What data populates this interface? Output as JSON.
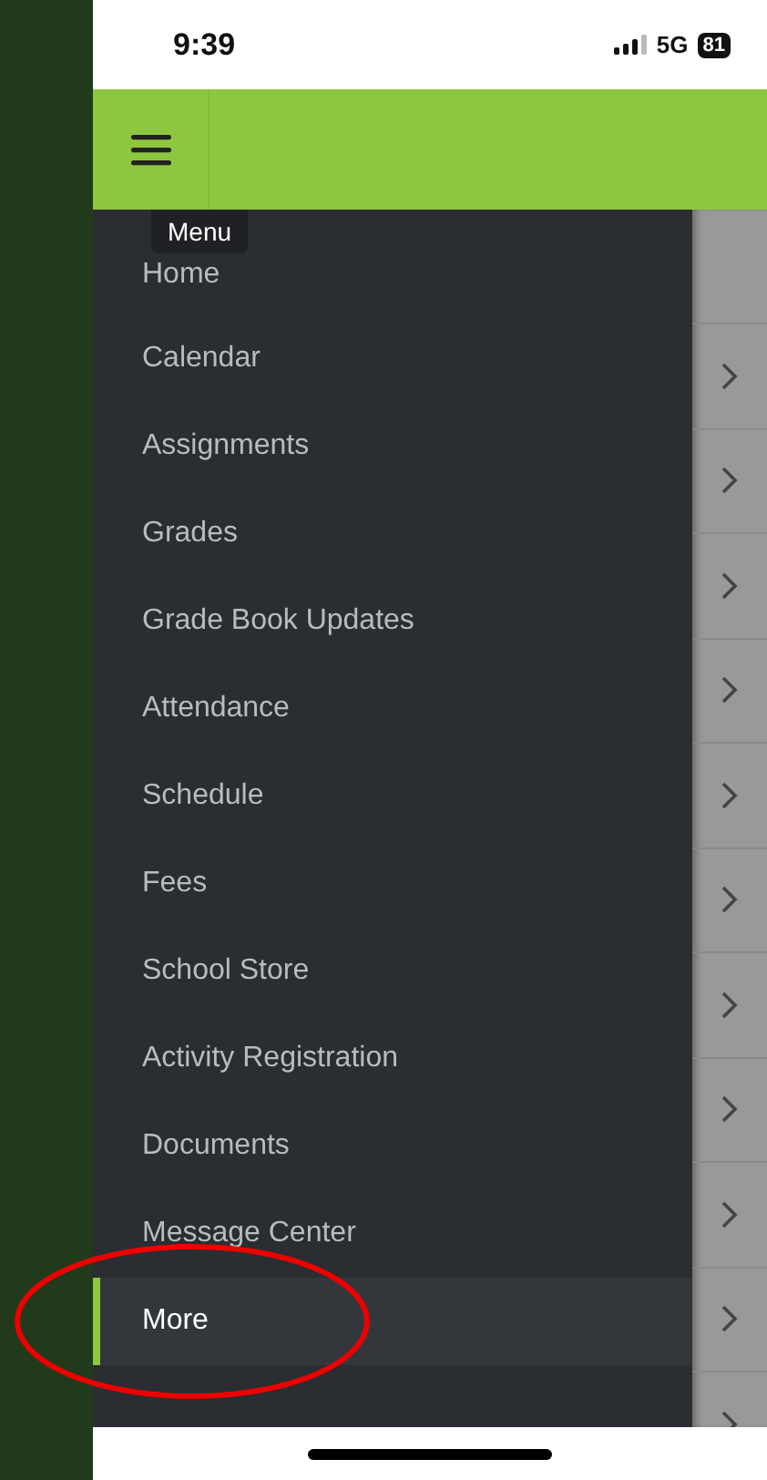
{
  "status_bar": {
    "time": "9:39",
    "network": "5G",
    "battery": "81"
  },
  "header": {
    "menu_tooltip": "Menu"
  },
  "menu": {
    "items": [
      {
        "label": "Home",
        "selected": false
      },
      {
        "label": "Calendar",
        "selected": false
      },
      {
        "label": "Assignments",
        "selected": false
      },
      {
        "label": "Grades",
        "selected": false
      },
      {
        "label": "Grade Book Updates",
        "selected": false
      },
      {
        "label": "Attendance",
        "selected": false
      },
      {
        "label": "Schedule",
        "selected": false
      },
      {
        "label": "Fees",
        "selected": false
      },
      {
        "label": "School Store",
        "selected": false
      },
      {
        "label": "Activity Registration",
        "selected": false
      },
      {
        "label": "Documents",
        "selected": false
      },
      {
        "label": "Message Center",
        "selected": false
      },
      {
        "label": "More",
        "selected": true
      }
    ]
  },
  "background_list": {
    "rows": [
      {
        "kind": "blank"
      },
      {
        "kind": "chevron"
      },
      {
        "kind": "chevron"
      },
      {
        "kind": "chevron"
      },
      {
        "kind": "chevron"
      },
      {
        "kind": "chevron"
      },
      {
        "kind": "chevron"
      },
      {
        "kind": "chevron"
      },
      {
        "kind": "chevron"
      },
      {
        "kind": "chevron"
      },
      {
        "kind": "chevron"
      },
      {
        "kind": "chevron"
      }
    ]
  },
  "annotation": {
    "kind": "ellipse"
  }
}
